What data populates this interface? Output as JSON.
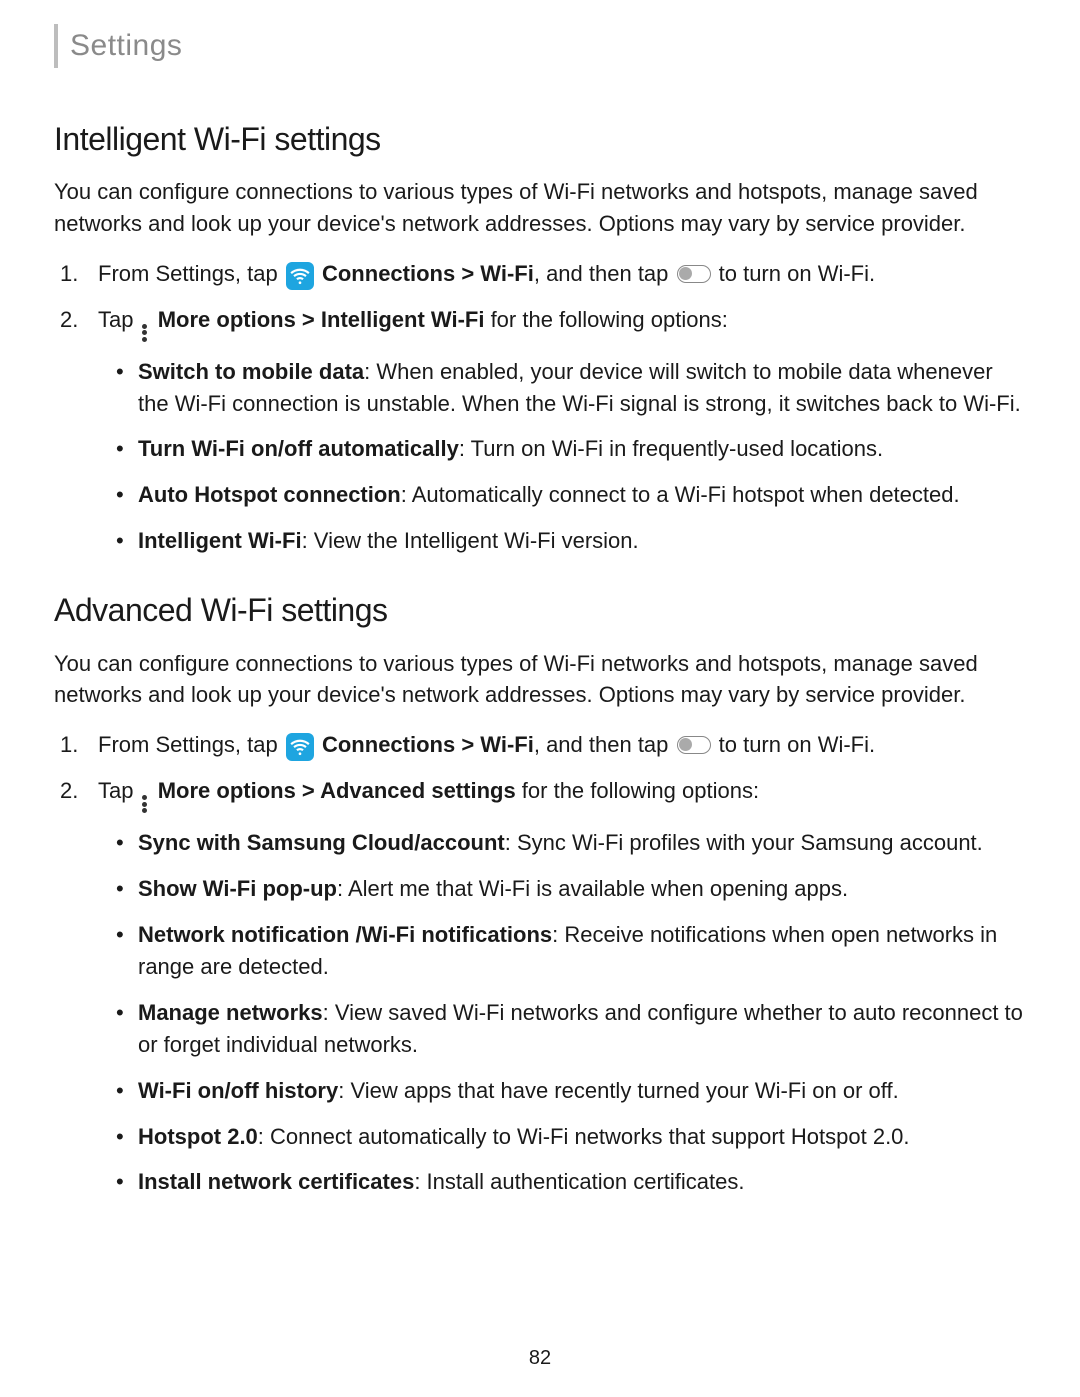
{
  "header": "Settings",
  "page_number": "82",
  "sections": [
    {
      "title": "Intelligent Wi-Fi settings",
      "intro": "You can configure connections to various types of Wi-Fi networks and hotspots, manage saved networks and look up your device's network addresses. Options may vary by service provider.",
      "steps": [
        {
          "num": "1.",
          "pre": "From Settings, tap ",
          "icon1": "wifi-icon",
          "bold1": "Connections > Wi-Fi",
          "mid": ", and then tap ",
          "icon2": "toggle-icon",
          "post": " to turn on Wi-Fi."
        },
        {
          "num": "2.",
          "pre": "Tap ",
          "icon1": "more-options-icon",
          "bold1": "More options > Intelligent Wi-Fi",
          "post": " for the following options:",
          "bullets": [
            {
              "bold": "Switch to mobile data",
              "text": ": When enabled, your device will switch to mobile data whenever the Wi-Fi connection is unstable. When the Wi-Fi signal is strong, it switches back to Wi-Fi."
            },
            {
              "bold": "Turn Wi-Fi on/off automatically",
              "text": ": Turn on Wi-Fi in frequently-used locations."
            },
            {
              "bold": "Auto Hotspot connection",
              "text": ": Automatically connect to a Wi-Fi hotspot when detected."
            },
            {
              "bold": "Intelligent Wi-Fi",
              "text": ": View the Intelligent Wi-Fi version."
            }
          ]
        }
      ]
    },
    {
      "title": "Advanced Wi-Fi settings",
      "intro": "You can configure connections to various types of Wi-Fi networks and hotspots, manage saved networks and look up your device's network addresses. Options may vary by service provider.",
      "steps": [
        {
          "num": "1.",
          "pre": "From Settings, tap ",
          "icon1": "wifi-icon",
          "bold1": "Connections > Wi-Fi",
          "mid": ", and then tap ",
          "icon2": "toggle-icon",
          "post": " to turn on Wi-Fi."
        },
        {
          "num": "2.",
          "pre": "Tap ",
          "icon1": "more-options-icon",
          "bold1": "More options > Advanced settings",
          "post": " for the following options:",
          "bullets": [
            {
              "bold": "Sync with Samsung Cloud/account",
              "text": ": Sync Wi-Fi profiles with your Samsung account."
            },
            {
              "bold": "Show Wi-Fi pop-up",
              "text": ": Alert me that Wi-Fi is available when opening apps."
            },
            {
              "bold": "Network notification /Wi-Fi notifications",
              "text": ": Receive notifications when open networks in range are detected."
            },
            {
              "bold": "Manage networks",
              "text": ": View saved Wi-Fi networks and configure whether to auto reconnect to or forget individual networks."
            },
            {
              "bold": "Wi-Fi on/off history",
              "text": ": View apps that have recently turned your Wi-Fi on or off."
            },
            {
              "bold": "Hotspot 2.0",
              "text": ": Connect automatically to Wi-Fi networks that support Hotspot 2.0."
            },
            {
              "bold": "Install network certificates",
              "text": ": Install authentication certificates."
            }
          ]
        }
      ]
    }
  ]
}
